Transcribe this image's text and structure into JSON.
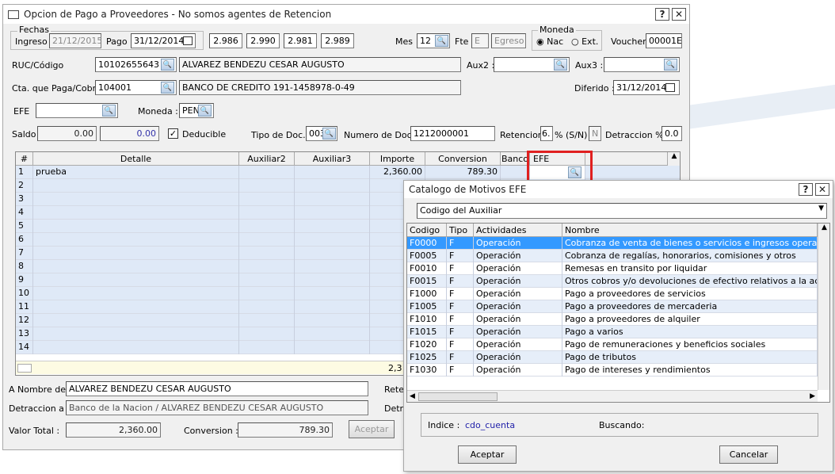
{
  "main": {
    "title": "Opcion de Pago a Proveedores - No somos agentes de Retencion",
    "help": "?",
    "close": "✕",
    "fechas_label": "Fechas",
    "ingreso_label": "Ingreso",
    "ingreso": "21/12/2015",
    "pago_label": "Pago",
    "pago": "31/12/2014",
    "tc": [
      "2.986",
      "2.990",
      "2.981",
      "2.989"
    ],
    "mes_label": "Mes",
    "mes": "12",
    "fte_label": "Fte",
    "fte": "E",
    "egreso": "Egreso",
    "moneda_label": "Moneda",
    "nac": "Nac",
    "ext": "Ext.",
    "voucher_label": "Voucher",
    "voucher": "00001E",
    "ruc_label": "RUC/Código",
    "ruc": "10102655643",
    "ruc_name": "ALVAREZ BENDEZU CESAR AUGUSTO",
    "aux2_label": "Aux2 :",
    "aux3_label": "Aux3 :",
    "cta_label": "Cta. que Paga/Cobra",
    "cta": "104001",
    "cta_name": "BANCO DE CREDITO 191-1458978-0-49",
    "diferido_label": "Diferido :",
    "diferido": "31/12/2014",
    "efe_label": "EFE",
    "moneda2_label": "Moneda :",
    "moneda2": "PEN",
    "saldo_label": "Saldo",
    "saldo1": "0.00",
    "saldo2": "0.00",
    "deducible": "Deducible",
    "tipo_doc_label": "Tipo de Doc.",
    "tipo_doc": "003",
    "num_doc_label": "Numero de Doc.",
    "num_doc": "1212000001",
    "retencion_label": "Retencion",
    "retencion": "6.",
    "sn_label": "% (S/N)",
    "sn": "N",
    "detraccion_label": "Detraccion %",
    "detraccion": "0.0",
    "grid_headers": [
      "#",
      "Detalle",
      "Auxiliar2",
      "Auxiliar3",
      "Importe",
      "Conversion",
      "Banco",
      "EFE"
    ],
    "row1": {
      "n": "1",
      "detalle": "prueba",
      "importe": "2,360.00",
      "conversion": "789.30"
    },
    "row_nums": [
      "2",
      "3",
      "4",
      "5",
      "6",
      "7",
      "8",
      "9",
      "10",
      "11",
      "12",
      "13",
      "14"
    ],
    "total_partial": "2,3",
    "anombre_label": "A Nombre de :",
    "anombre": "ALVAREZ BENDEZU CESAR AUGUSTO",
    "rete_label": "Rete",
    "detr_label": "Detraccion a :",
    "detr": "Banco de la Nacion / ALVAREZ BENDEZU CESAR AUGUSTO",
    "detra_label": "Detra",
    "valor_label": "Valor Total :",
    "valor": "2,360.00",
    "conv_label": "Conversion :",
    "conv": "789.30",
    "aceptar": "Aceptar"
  },
  "dialog": {
    "title": "Catalogo de Motivos EFE",
    "help": "?",
    "close": "✕",
    "combo": "Codigo del Auxiliar",
    "headers": [
      "Codigo",
      "Tipo",
      "Actividades",
      "Nombre"
    ],
    "rows": [
      {
        "c": "F0000",
        "t": "F",
        "a": "Operación",
        "n": "Cobranza de venta de bienes o servicios e ingresos operacion"
      },
      {
        "c": "F0005",
        "t": "F",
        "a": "Operación",
        "n": "Cobranza de regalías, honorarios, comisiones y otros"
      },
      {
        "c": "F0010",
        "t": "F",
        "a": "Operación",
        "n": "Remesas en transito por liquidar"
      },
      {
        "c": "F0015",
        "t": "F",
        "a": "Operación",
        "n": "Otros cobros y/o devoluciones de efectivo relativos a la act"
      },
      {
        "c": "F1000",
        "t": "F",
        "a": "Operación",
        "n": "Pago a proveedores de servicios"
      },
      {
        "c": "F1005",
        "t": "F",
        "a": "Operación",
        "n": "Pago a proveedores de mercaderia"
      },
      {
        "c": "F1010",
        "t": "F",
        "a": "Operación",
        "n": "Pago a proveedores de alquiler"
      },
      {
        "c": "F1015",
        "t": "F",
        "a": "Operación",
        "n": "Pago a varios"
      },
      {
        "c": "F1020",
        "t": "F",
        "a": "Operación",
        "n": "Pago de remuneraciones y beneficios sociales"
      },
      {
        "c": "F1025",
        "t": "F",
        "a": "Operación",
        "n": "Pago de tributos"
      },
      {
        "c": "F1030",
        "t": "F",
        "a": "Operación",
        "n": "Pago de intereses y rendimientos"
      }
    ],
    "indice_label": "Indice :",
    "indice": "cdo_cuenta",
    "buscando_label": "Buscando:",
    "aceptar": "Aceptar",
    "cancelar": "Cancelar"
  }
}
